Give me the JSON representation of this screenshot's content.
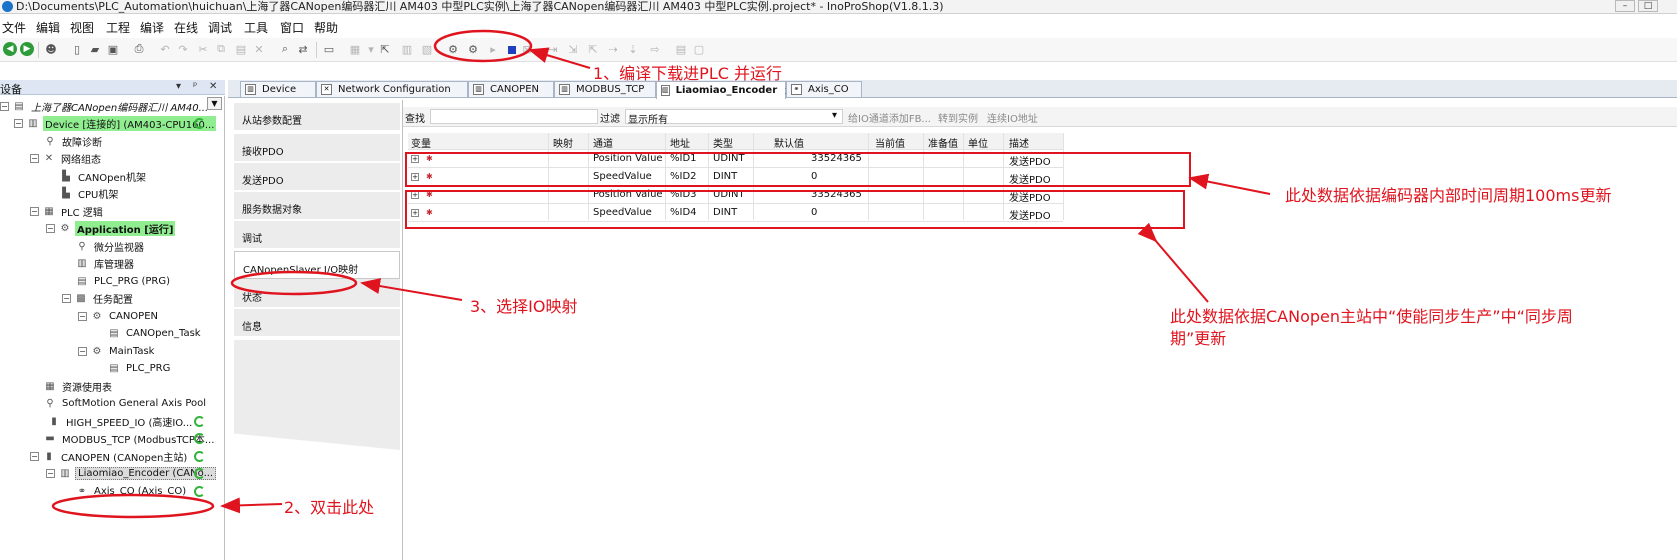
{
  "window": {
    "title": "D:\\Documents\\PLC_Automation\\huichuan\\上海了器CANopen编码器汇川 AM403 中型PLC实例\\上海了器CANopen编码器汇川 AM403 中型PLC实例.project* - InoProShop(V1.8.1.3)",
    "min_label": "–",
    "max_label": "□"
  },
  "menu": [
    "文件",
    "编辑",
    "视图",
    "工程",
    "编译",
    "在线",
    "调试",
    "工具",
    "窗口",
    "帮助"
  ],
  "devices_panel": {
    "title": "设备",
    "controls": [
      "▾",
      "ᵖ",
      "✕"
    ]
  },
  "tree": [
    {
      "label": "上海了器CANopen编码器汇川 AM40..."
    },
    {
      "label": "Device [连接的] (AM403-CPU160..."
    },
    {
      "label": "故障诊断"
    },
    {
      "label": "网络组态"
    },
    {
      "label": "CANOpen机架"
    },
    {
      "label": "CPU机架"
    },
    {
      "label": "PLC 逻辑"
    },
    {
      "label": "Application [运行]"
    },
    {
      "label": "微分监视器"
    },
    {
      "label": "库管理器"
    },
    {
      "label": "PLC_PRG (PRG)"
    },
    {
      "label": "任务配置"
    },
    {
      "label": "CANOPEN"
    },
    {
      "label": "CANOpen_Task"
    },
    {
      "label": "MainTask"
    },
    {
      "label": "PLC_PRG"
    },
    {
      "label": "资源使用表"
    },
    {
      "label": "SoftMotion General Axis Pool"
    },
    {
      "label": "HIGH_SPEED_IO (高速IO..."
    },
    {
      "label": "MODBUS_TCP (ModbusTCP本..."
    },
    {
      "label": "CANOPEN (CANopen主站)"
    },
    {
      "label": "Liaomiao_Encoder (CANo..."
    },
    {
      "label": "Axis_CO (Axis_CO)"
    }
  ],
  "tabs": [
    {
      "label": "Device"
    },
    {
      "label": "Network Configuration"
    },
    {
      "label": "CANOPEN"
    },
    {
      "label": "MODBUS_TCP"
    },
    {
      "label": "Liaomiao_Encoder",
      "active": true
    },
    {
      "label": "Axis_CO"
    }
  ],
  "tab_close": "x",
  "subnav": [
    "从站参数配置",
    "接收PDO",
    "发送PDO",
    "服务数据对象",
    "调试",
    "CANopenSlaver I/O映射",
    "状态",
    "信息"
  ],
  "filterbar": {
    "search_label": "查找",
    "filter_label": "过滤",
    "filter_value": "显示所有",
    "add_fb": "给IO通道添加FB...",
    "goto_instance": "转到实例",
    "online_io": "连续IO地址"
  },
  "table": {
    "headers": [
      "变量",
      "映射",
      "通道",
      "地址",
      "类型",
      "默认值",
      "当前值",
      "准备值",
      "单位",
      "描述"
    ],
    "rows": [
      {
        "channel": "Position Value",
        "address": "%ID1",
        "type": "UDINT",
        "default": "33524365",
        "desc": "发送PDO"
      },
      {
        "channel": "SpeedValue",
        "address": "%ID2",
        "type": "DINT",
        "default": "0",
        "desc": "发送PDO"
      },
      {
        "channel": "Position Value",
        "address": "%ID3",
        "type": "UDINT",
        "default": "33524365",
        "desc": "发送PDO"
      },
      {
        "channel": "SpeedValue",
        "address": "%ID4",
        "type": "DINT",
        "default": "0",
        "desc": "发送PDO"
      }
    ]
  },
  "annotations": {
    "step1": "1、编译下载进PLC 并运行",
    "step2": "2、双击此处",
    "step3": "3、选择IO映射",
    "note_top": "此处数据依据编码器内部时间周期100ms更新",
    "note_bottom": "此处数据依据CANopen主站中“使能同步生产”中“同步周期”更新"
  },
  "colors": {
    "annotation_red": "#e0141e",
    "running_green": "#90ee90"
  }
}
